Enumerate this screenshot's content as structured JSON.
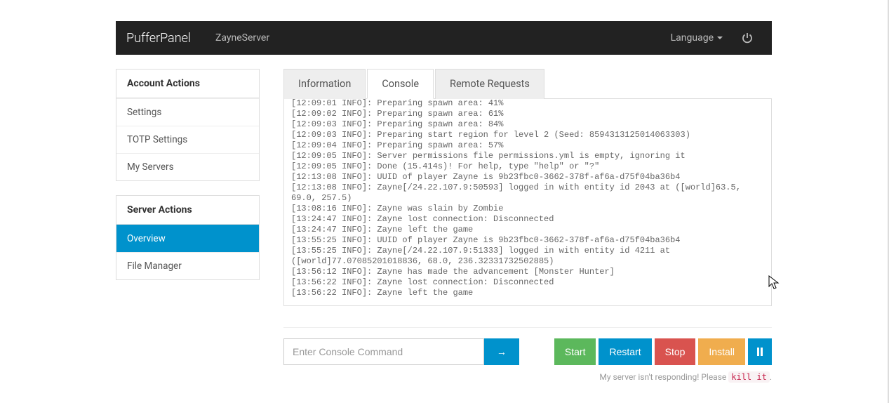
{
  "navbar": {
    "brand": "PufferPanel",
    "server": "ZayneServer",
    "language_label": "Language"
  },
  "sidebar": {
    "account": {
      "heading": "Account Actions",
      "items": [
        "Settings",
        "TOTP Settings",
        "My Servers"
      ]
    },
    "server": {
      "heading": "Server Actions",
      "items": [
        "Overview",
        "File Manager"
      ],
      "active_index": 0
    }
  },
  "tabs": {
    "items": [
      "Information",
      "Console",
      "Remote Requests"
    ],
    "active_index": 1
  },
  "console": {
    "lines": [
      "[12:09:01 INFO]: Preparing spawn area: 41%",
      "[12:09:02 INFO]: Preparing spawn area: 61%",
      "[12:09:03 INFO]: Preparing spawn area: 84%",
      "[12:09:03 INFO]: Preparing start region for level 2 (Seed: 8594313125014063303)",
      "[12:09:04 INFO]: Preparing spawn area: 57%",
      "[12:09:05 INFO]: Server permissions file permissions.yml is empty, ignoring it",
      "[12:09:05 INFO]: Done (15.414s)! For help, type \"help\" or \"?\"",
      "[12:13:08 INFO]: UUID of player Zayne is 9b23fbc0-3662-378f-af6a-d75f04ba36b4",
      "[12:13:08 INFO]: Zayne[/24.22.107.9:50593] logged in with entity id 2043 at ([world]63.5, 69.0, 257.5)",
      "[13:08:16 INFO]: Zayne was slain by Zombie",
      "[13:24:47 INFO]: Zayne lost connection: Disconnected",
      "[13:24:47 INFO]: Zayne left the game",
      "[13:55:25 INFO]: UUID of player Zayne is 9b23fbc0-3662-378f-af6a-d75f04ba36b4",
      "[13:55:25 INFO]: Zayne[/24.22.107.9:51333] logged in with entity id 4211 at ([world]77.07085201018836, 68.0, 236.32331732502885)",
      "[13:56:12 INFO]: Zayne has made the advancement [Monster Hunter]",
      "[13:56:22 INFO]: Zayne lost connection: Disconnected",
      "[13:56:22 INFO]: Zayne left the game"
    ],
    "input_placeholder": "Enter Console Command",
    "send_label": "→"
  },
  "buttons": {
    "start": "Start",
    "restart": "Restart",
    "stop": "Stop",
    "install": "Install"
  },
  "kill": {
    "prefix": "My server isn't responding! Please ",
    "action": "kill it",
    "suffix": "."
  }
}
